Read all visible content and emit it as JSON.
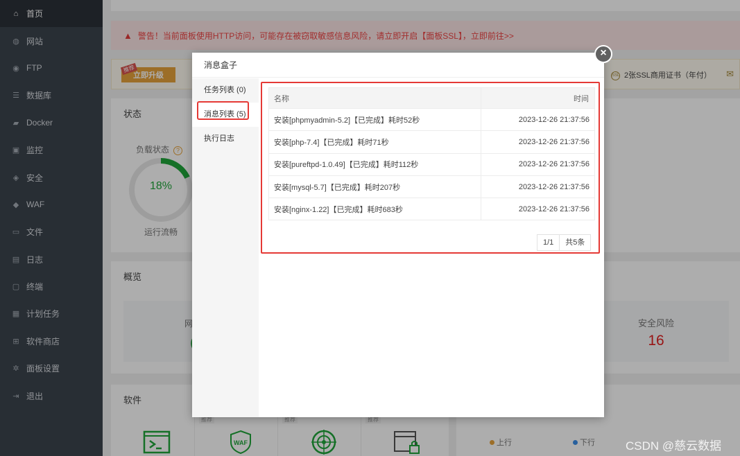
{
  "sidebar": {
    "items": [
      {
        "label": "首页",
        "icon": "home-icon"
      },
      {
        "label": "网站",
        "icon": "globe-icon"
      },
      {
        "label": "FTP",
        "icon": "ftp-icon"
      },
      {
        "label": "数据库",
        "icon": "database-icon"
      },
      {
        "label": "Docker",
        "icon": "docker-icon"
      },
      {
        "label": "监控",
        "icon": "monitor-icon"
      },
      {
        "label": "安全",
        "icon": "shield-icon"
      },
      {
        "label": "WAF",
        "icon": "waf-icon"
      },
      {
        "label": "文件",
        "icon": "folder-icon"
      },
      {
        "label": "日志",
        "icon": "log-icon"
      },
      {
        "label": "终端",
        "icon": "terminal-icon"
      },
      {
        "label": "计划任务",
        "icon": "calendar-icon"
      },
      {
        "label": "软件商店",
        "icon": "apps-icon"
      },
      {
        "label": "面板设置",
        "icon": "gear-icon"
      },
      {
        "label": "退出",
        "icon": "logout-icon"
      }
    ]
  },
  "warning": {
    "text": "警告！当前面板使用HTTP访问，可能存在被窃取敏感信息风险，请立即开启【面板SSL】，立即前往>>"
  },
  "promo": {
    "badge": "推荐",
    "upgrade": "立即升级",
    "ssl_text": "2张SSL商用证书（年付）"
  },
  "status": {
    "title": "状态",
    "load_label": "负载状态",
    "load_value": "18%",
    "load_fraction": 0.18,
    "load_caption": "运行流畅"
  },
  "overview": {
    "title": "概览",
    "left_label_partial": "网",
    "left_value_partial": "(",
    "risk_label": "安全风险",
    "risk_value": "16"
  },
  "software": {
    "title": "软件",
    "tiles": [
      {
        "badge": "",
        "icon": "terminal-icon",
        "text": ">_"
      },
      {
        "badge": "推荐",
        "icon": "waf-icon",
        "text": "WAF"
      },
      {
        "badge": "推荐",
        "icon": "target-icon",
        "text": "◎"
      },
      {
        "badge": "推荐",
        "icon": "lock-window-icon",
        "text": "🔒"
      }
    ]
  },
  "network": {
    "up_label": "上行",
    "down_label": "下行",
    "up_color": "#e6a23c",
    "down_color": "#3b8ee8"
  },
  "dialog": {
    "title": "消息盒子",
    "close_icon": "close-icon",
    "tabs": [
      {
        "label": "任务列表 (0)"
      },
      {
        "label": "消息列表 (5)"
      },
      {
        "label": "执行日志"
      }
    ],
    "table": {
      "col_name": "名称",
      "col_time": "时间",
      "rows": [
        {
          "name": "安装[phpmyadmin-5.2]【已完成】耗时52秒",
          "time": "2023-12-26 21:37:56"
        },
        {
          "name": "安装[php-7.4]【已完成】耗时71秒",
          "time": "2023-12-26 21:37:56"
        },
        {
          "name": "安装[pureftpd-1.0.49]【已完成】耗时112秒",
          "time": "2023-12-26 21:37:56"
        },
        {
          "name": "安装[mysql-5.7]【已完成】耗时207秒",
          "time": "2023-12-26 21:37:56"
        },
        {
          "name": "安装[nginx-1.22]【已完成】耗时683秒",
          "time": "2023-12-26 21:37:56"
        }
      ]
    },
    "pager": {
      "page": "1/1",
      "total": "共5条"
    }
  },
  "watermark": "CSDN @慈云数据",
  "colors": {
    "accent_green": "#20a53a",
    "highlight_red": "#e53935",
    "warning_red": "#ef4444"
  }
}
